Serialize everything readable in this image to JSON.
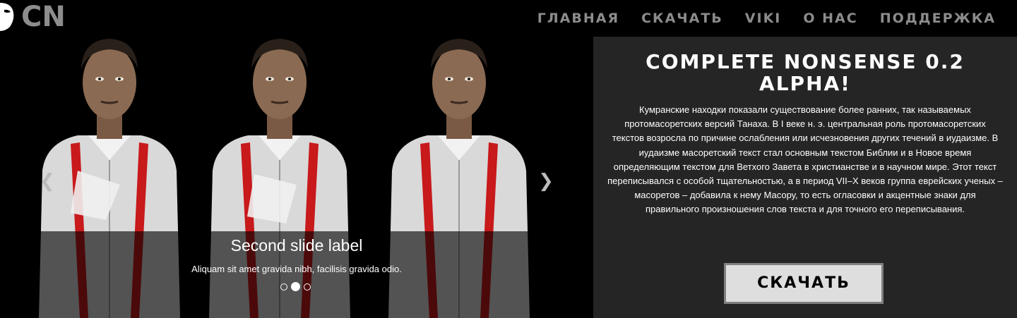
{
  "header": {
    "logo_text": "CN",
    "nav": [
      "ГЛАВНАЯ",
      "СКАЧАТЬ",
      "VIKI",
      "О НАС",
      "ПОДДЕРЖКА"
    ]
  },
  "carousel": {
    "caption_title": "Second slide label",
    "caption_text": "Aliquam sit amet gravida nibh, facilisis gravida odio.",
    "slide_count": 3,
    "active_slide": 2,
    "prev_icon": "chevron-left-icon",
    "next_icon": "chevron-right-icon"
  },
  "panel": {
    "title": "COMPLETE NONSENSE 0.2 ALPHA!",
    "body": "Кумранские находки показали существование более ранних, так называемых протомасоретских версий Танаха. В I веке н. э. центральная роль протомасоретских текстов возросла по причине ослабления или исчезновения других течений в иудаизме. В иудаизме масоретский текст стал основным текстом Библии и в Новое время определяющим текстом для Ветхого Завета в христианстве и в научном мире. Этот текст переписывался с особой тщательностью, а в период VII–X веков группа еврейских ученых – масоретов – добавила к нему Масору, то есть огласовки и акцентные знаки для правильного произношения слов текста и для точного его переписывания.",
    "button_label": "СКАЧАТЬ"
  },
  "colors": {
    "background": "#000000",
    "panel": "#252525",
    "nav_text": "#8c8c8c",
    "suspenders": "#c8191b",
    "button": "#dedede"
  }
}
